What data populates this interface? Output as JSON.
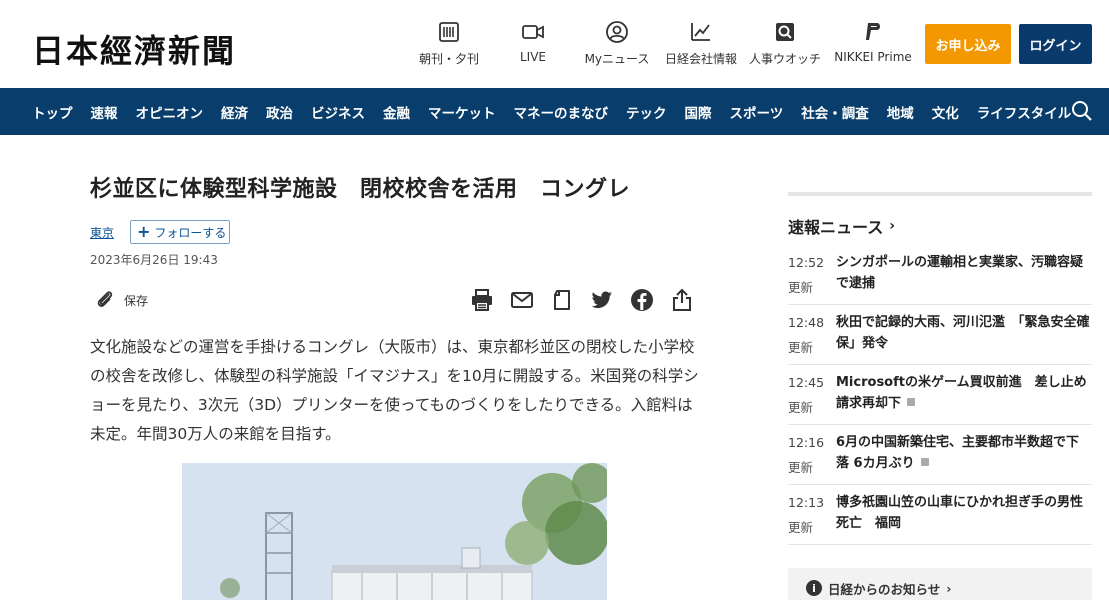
{
  "header": {
    "logo": "日本經濟新聞",
    "icons": [
      {
        "label": "朝刊・夕刊",
        "icon": "newspaper-icon"
      },
      {
        "label": "LIVE",
        "icon": "video-camera-icon"
      },
      {
        "label": "Myニュース",
        "icon": "user-icon"
      },
      {
        "label": "日経会社情報",
        "icon": "chart-icon"
      },
      {
        "label": "人事ウオッチ",
        "icon": "magnifier-icon"
      },
      {
        "label": "NIKKEI Prime",
        "icon": "prime-icon"
      }
    ],
    "subscribe_label": "お申し込み",
    "login_label": "ログイン"
  },
  "nav": {
    "items": [
      "トップ",
      "速報",
      "オピニオン",
      "経済",
      "政治",
      "ビジネス",
      "金融",
      "マーケット",
      "マネーのまなび",
      "テック",
      "国際",
      "スポーツ",
      "社会・調査",
      "地域",
      "文化",
      "ライフスタイル"
    ]
  },
  "article": {
    "title": "杉並区に体験型科学施設　閉校校舎を活用　コングレ",
    "tag": "東京",
    "follow_label": "フォローする",
    "date": "2023年6月26日 19:43",
    "save_label": "保存",
    "body": "文化施設などの運営を手掛けるコングレ（大阪市）は、東京都杉並区の閉校した小学校の校舎を改修し、体験型の科学施設「イマジナス」を10月に開設する。米国発の科学ショーを見たり、3次元（3D）プリンターを使ってものづくりをしたりできる。入館料は未定。年間30万人の来館を目指す。"
  },
  "sidebar": {
    "heading": "速報ニュース",
    "news": [
      {
        "time": "12:52",
        "category": "更新",
        "title": "シンガポールの運輸相と実業家、汚職容疑で逮捕",
        "locked": false
      },
      {
        "time": "12:48",
        "category": "更新",
        "title": "秋田で記録的大雨、河川氾濫　「緊急安全確保」発令",
        "locked": false
      },
      {
        "time": "12:45",
        "category": "更新",
        "title": "Microsoftの米ゲーム買収前進　差し止め請求再却下",
        "locked": true
      },
      {
        "time": "12:16",
        "category": "更新",
        "title": "6月の中国新築住宅、主要都市半数超で下落 6カ月ぶり",
        "locked": true
      },
      {
        "time": "12:13",
        "category": "更新",
        "title": "博多祇園山笠の山車にひかれ担ぎ手の男性死亡　福岡",
        "locked": false
      }
    ],
    "notice": "日経からのお知らせ"
  }
}
